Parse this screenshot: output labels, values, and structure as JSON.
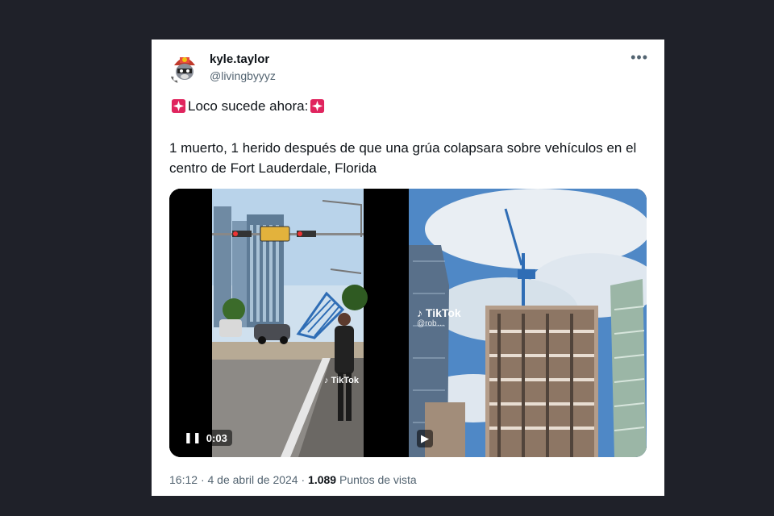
{
  "tweet": {
    "display_name": "kyle.taylor",
    "handle": "@livingbyyyz",
    "more_icon": "•••",
    "line1": "Loco sucede ahora:",
    "line2": "1 muerto, 1 herido después de que una grúa colapsara sobre vehículos en el centro de Fort Lauderdale, Florida",
    "media": {
      "left_video_time": "0:03",
      "left_watermark": "TikTok",
      "right_watermark": "TikTok",
      "right_watermark_user": "@rob…"
    },
    "footer": {
      "time": "16:12",
      "date": "4 de abril de 2024",
      "views_count": "1.089",
      "views_label": "Puntos de vista"
    }
  },
  "colors": {
    "background": "#1f2129",
    "card": "#ffffff",
    "text": "#0f1419",
    "muted": "#536471",
    "siren": "#e0245e"
  }
}
